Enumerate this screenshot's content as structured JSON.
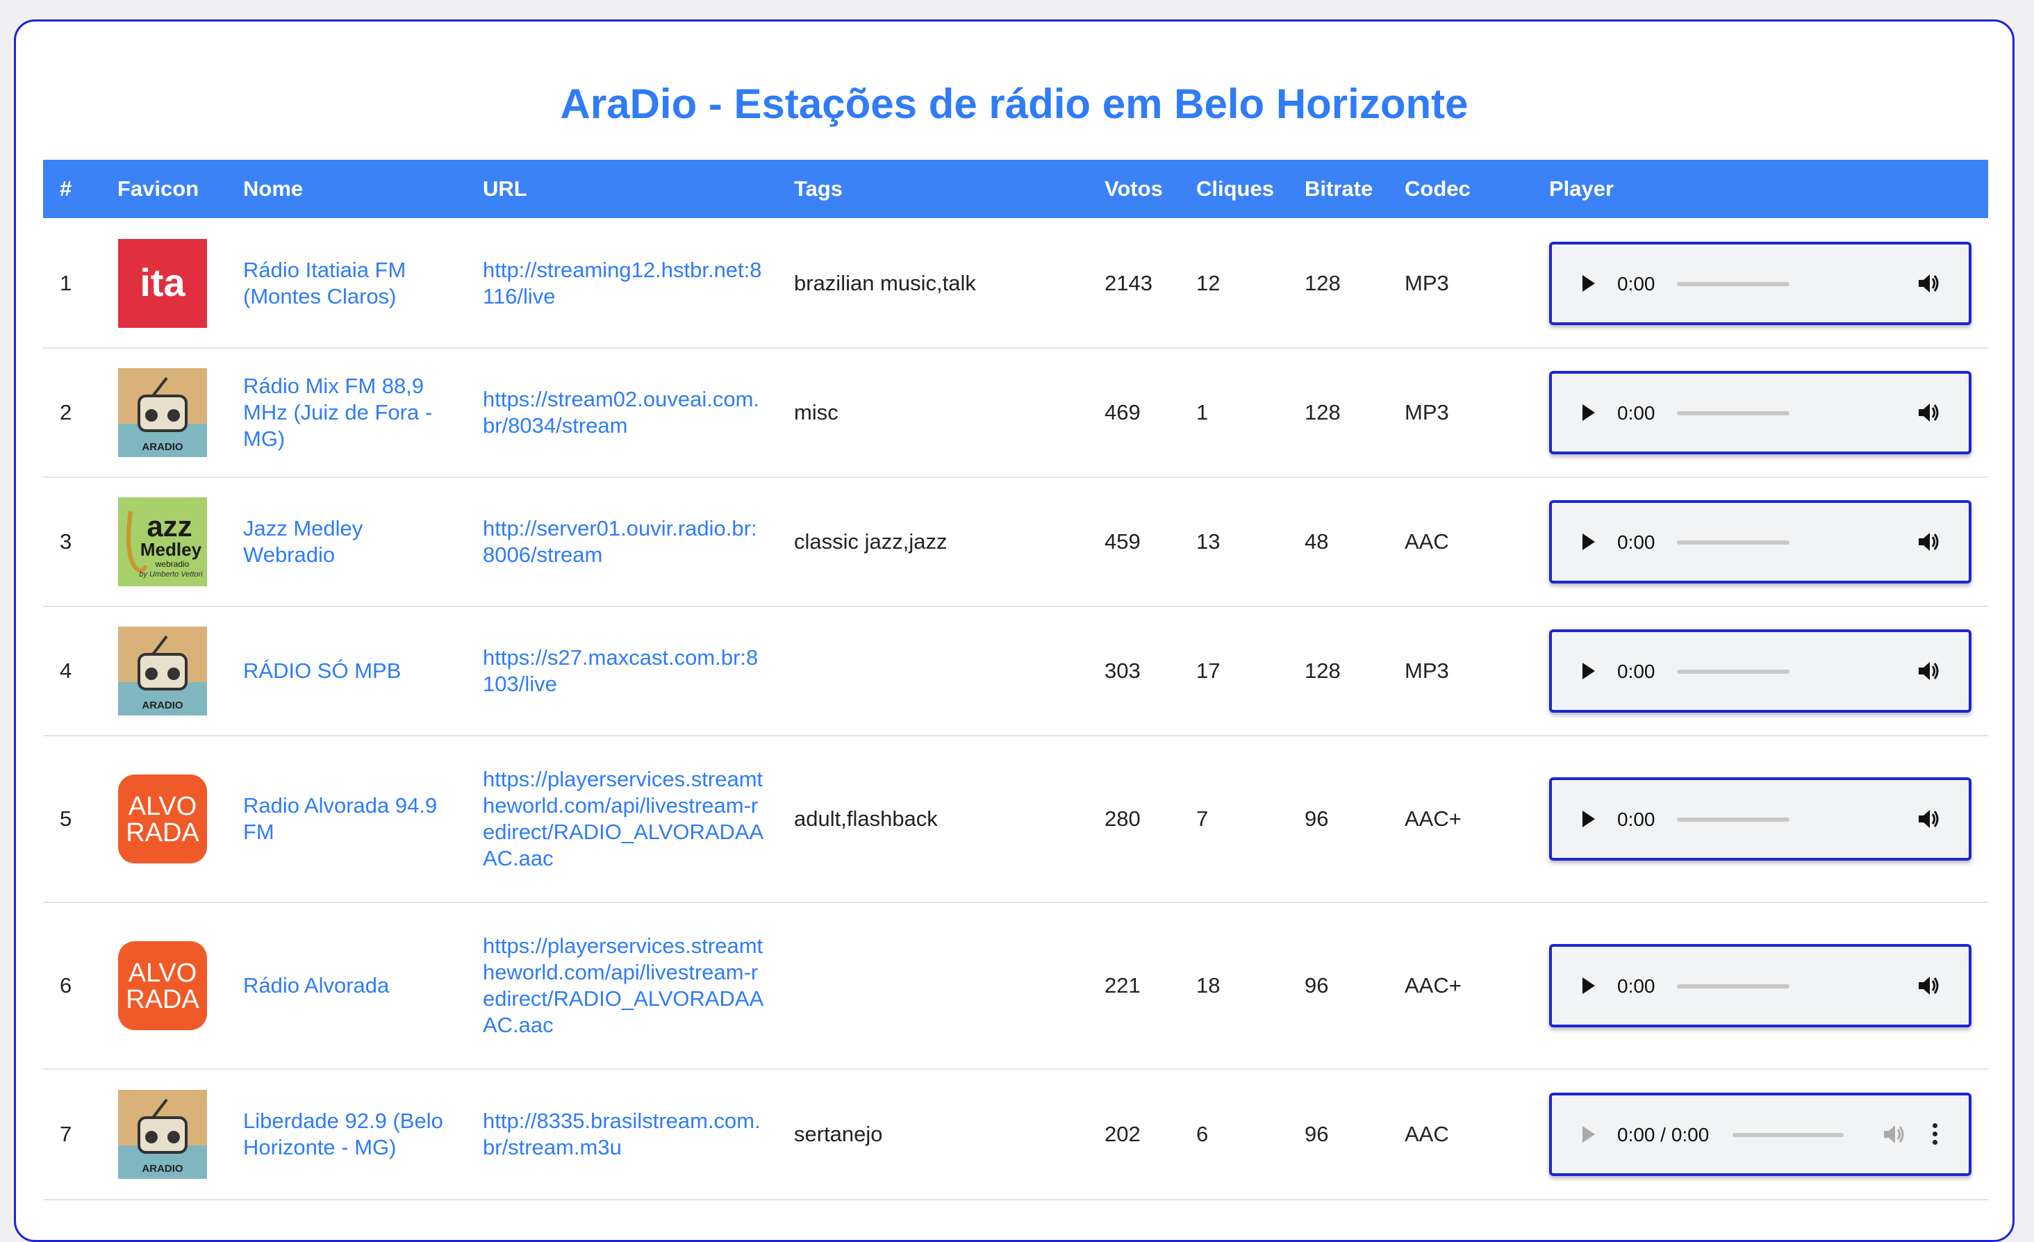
{
  "page": {
    "title": "AraDio - Estações de rádio em Belo Horizonte"
  },
  "colors": {
    "accent": "#2f7cf6",
    "header_bg": "#3b82f6",
    "player_border": "#1d24d6"
  },
  "table": {
    "columns": [
      "#",
      "Favicon",
      "Nome",
      "URL",
      "Tags",
      "Votos",
      "Cliques",
      "Bitrate",
      "Codec",
      "Player"
    ],
    "rows": [
      {
        "num": "1",
        "favicon": "itatiaia-logo",
        "favicon_text": "ita",
        "name": "Rádio Itatiaia FM (Montes Claros)",
        "url": "http://streaming12.hstbr.net:8116/live",
        "tags": "brazilian music,talk",
        "votes": "2143",
        "clicks": "12",
        "bitrate": "128",
        "codec": "MP3",
        "player_time": "0:00"
      },
      {
        "num": "2",
        "favicon": "aradio-radio-logo",
        "favicon_text": "ARADIO",
        "name": "Rádio Mix FM 88,9 MHz (Juiz de Fora - MG)",
        "url": "https://stream02.ouveai.com.br/8034/stream",
        "tags": "misc",
        "votes": "469",
        "clicks": "1",
        "bitrate": "128",
        "codec": "MP3",
        "player_time": "0:00"
      },
      {
        "num": "3",
        "favicon": "jazz-medley-logo",
        "favicon_text": "Jazz Medley webradio by Umberto Vettori",
        "name": "Jazz Medley Webradio",
        "url": "http://server01.ouvir.radio.br:8006/stream",
        "tags": "classic jazz,jazz",
        "votes": "459",
        "clicks": "13",
        "bitrate": "48",
        "codec": "AAC",
        "player_time": "0:00"
      },
      {
        "num": "4",
        "favicon": "aradio-radio-logo",
        "favicon_text": "ARADIO",
        "name": "RÁDIO SÓ MPB",
        "url": "https://s27.maxcast.com.br:8103/live",
        "tags": "",
        "votes": "303",
        "clicks": "17",
        "bitrate": "128",
        "codec": "MP3",
        "player_time": "0:00"
      },
      {
        "num": "5",
        "favicon": "alvorada-logo",
        "favicon_text": "ALVO RADA",
        "name": "Radio Alvorada 94.9 FM",
        "url": "https://playerservices.streamtheworld.com/api/livestream-redirect/RADIO_ALVORADAAAC.aac",
        "tags": "adult,flashback",
        "votes": "280",
        "clicks": "7",
        "bitrate": "96",
        "codec": "AAC+",
        "player_time": "0:00"
      },
      {
        "num": "6",
        "favicon": "alvorada-logo",
        "favicon_text": "ALVO RADA",
        "name": "Rádio Alvorada",
        "url": "https://playerservices.streamtheworld.com/api/livestream-redirect/RADIO_ALVORADAAAC.aac",
        "tags": "",
        "votes": "221",
        "clicks": "18",
        "bitrate": "96",
        "codec": "AAC+",
        "player_time": "0:00"
      },
      {
        "num": "7",
        "favicon": "aradio-radio-logo",
        "favicon_text": "ARADIO",
        "name": "Liberdade 92.9 (Belo Horizonte - MG)",
        "url": "http://8335.brasilstream.com.br/stream.m3u",
        "tags": "sertanejo",
        "votes": "202",
        "clicks": "6",
        "bitrate": "96",
        "codec": "AAC",
        "player_time": "0:00 / 0:00"
      }
    ]
  }
}
